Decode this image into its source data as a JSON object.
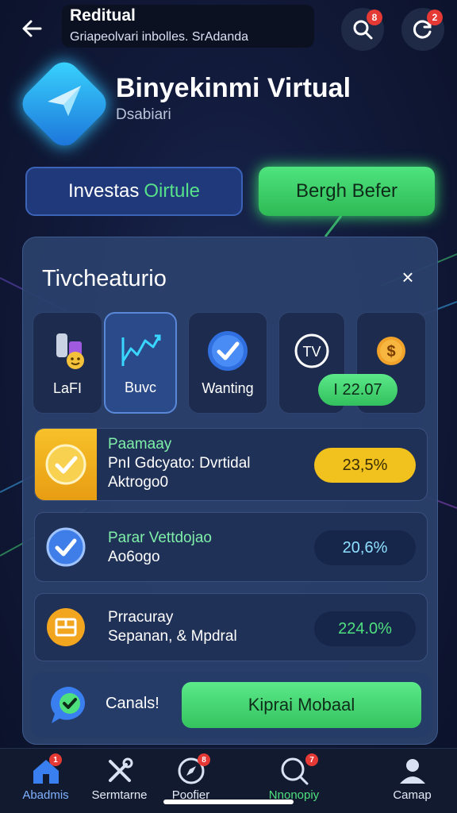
{
  "header": {
    "title": "Reditual",
    "subtitle": "Griapeolvari inbolles. SrAdanda",
    "search_badge": "8",
    "refresh_badge": "2"
  },
  "app": {
    "name": "Binyekinmi Virtual",
    "subtitle": "Dsabiari"
  },
  "actions": {
    "invest_prefix": "Investas",
    "invest_highlight": "Oirtule",
    "begin_label": "Bergh Befer"
  },
  "panel": {
    "title": "Tivcheaturio",
    "close_glyph": "×",
    "categories": [
      {
        "label": "LaFI",
        "icon": "tools-icon"
      },
      {
        "label": "Buvc",
        "icon": "chart-icon"
      },
      {
        "label": "Wanting",
        "icon": "check-icon"
      },
      {
        "label": "",
        "icon": "tv-coin-icon"
      },
      {
        "label": "",
        "icon": "dollar-coin-icon"
      }
    ],
    "category_pill": "I 22.07",
    "tv_icon_text": "TV",
    "rows": [
      {
        "name": "Paamaay",
        "line2": "PnI Gdcyato: Dvrtidal",
        "line3": "Aktrogo0",
        "value": "23,5%"
      },
      {
        "name": "Parar Vettdojao",
        "line2": "Ao6ogo",
        "value": "20,6%"
      },
      {
        "name": "Prracuray",
        "line2": "Sepanan, & Mpdral",
        "value": "224.0%"
      }
    ],
    "cancel_label": "Canals!",
    "confirm_label": "Kiprai Mobaal"
  },
  "nav": {
    "items": [
      {
        "label": "Abadmis",
        "badge": "1",
        "icon": "home-icon"
      },
      {
        "label": "Sermtarne",
        "badge": "",
        "icon": "tools-icon"
      },
      {
        "label": "Poofier",
        "badge": "8",
        "icon": "compass-icon"
      },
      {
        "label": "Nnonopiy",
        "badge": "7",
        "icon": "chat-search-icon"
      },
      {
        "label": "Camap",
        "badge": "",
        "icon": "profile-icon"
      }
    ]
  },
  "colors": {
    "accent_green": "#4ee47e",
    "accent_blue": "#3b63b8",
    "gold": "#f1c21d",
    "badge_red": "#e53935"
  }
}
